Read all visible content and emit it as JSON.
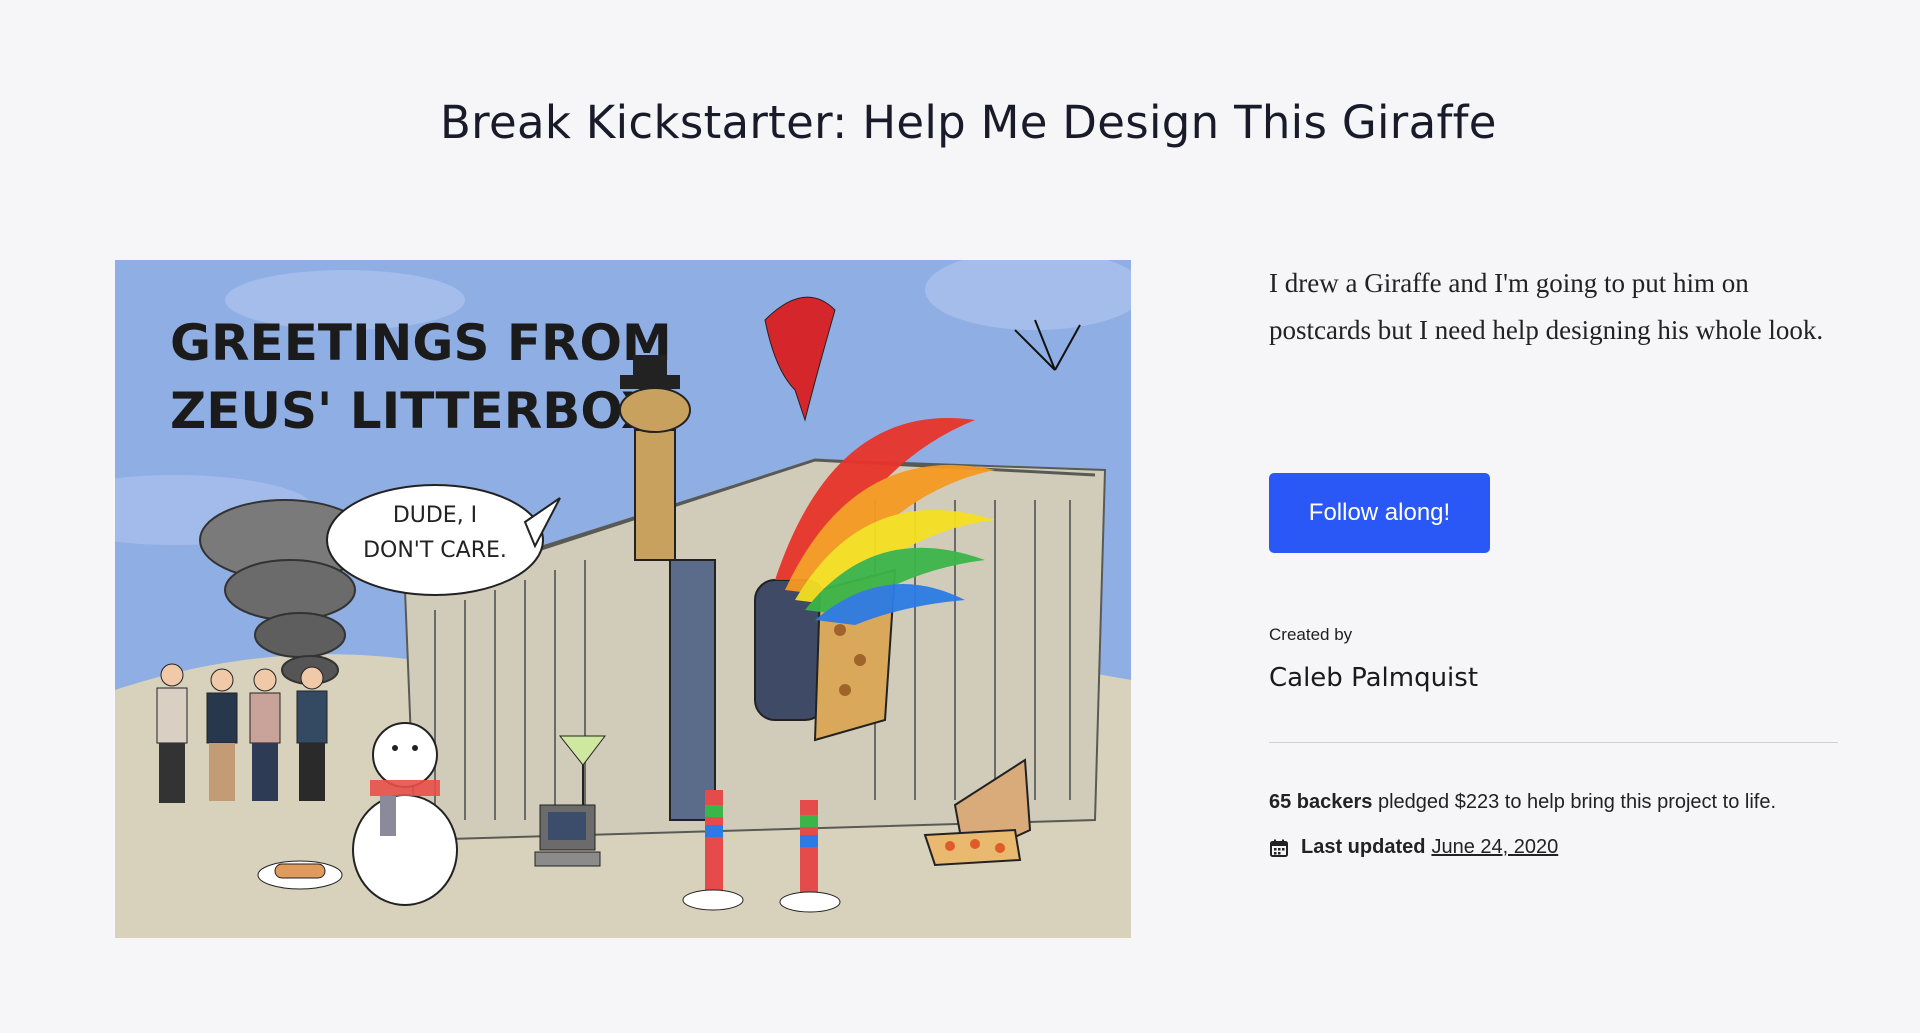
{
  "project": {
    "title": "Break Kickstarter: Help Me Design This Giraffe",
    "description": "I drew a Giraffe and I'm going to put him on postcards but I need help designing his whole look.",
    "follow_label": "Follow along!",
    "created_by_label": "Created by",
    "creator": "Caleb Palmquist",
    "backers_count": "65 backers",
    "pledge_text": " pledged $223 to help bring this project to life.",
    "last_updated_label": "Last updated",
    "last_updated_date": "June 24, 2020"
  },
  "hero_image": {
    "headline_line1": "GREETINGS FROM",
    "headline_line2": "ZEUS' LITTERBOX!",
    "speech_line1": "DUDE, I",
    "speech_line2": "DON'T CARE."
  },
  "icons": {
    "calendar": "calendar-icon"
  },
  "colors": {
    "accent": "#2a58f6",
    "background": "#f6f6f8"
  }
}
